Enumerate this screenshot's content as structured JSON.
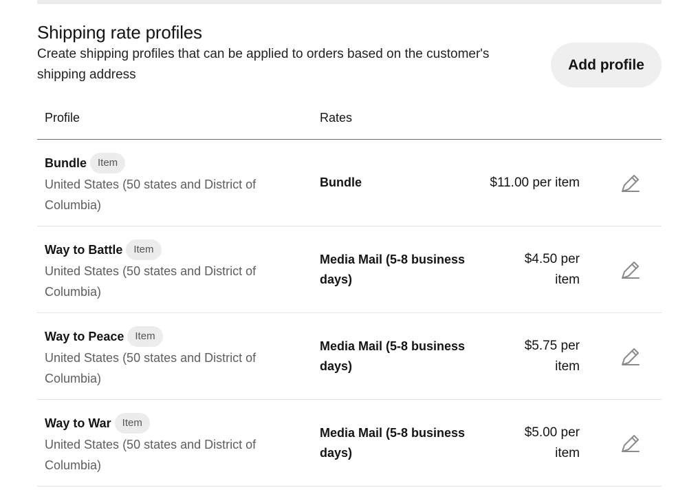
{
  "section": {
    "title": "Shipping rate profiles",
    "description": "Create shipping profiles that can be applied to orders based on the customer's shipping address",
    "add_button_label": "Add profile"
  },
  "table": {
    "columns": [
      "Profile",
      "Rates"
    ],
    "rows": [
      {
        "name": "Bundle",
        "badge": "Item",
        "region": "United States (50 states and District of Columbia)",
        "rate_name": "Bundle",
        "rate_price": "$11.00 per item",
        "edit_icon": "pencil-icon"
      },
      {
        "name": "Way to Battle",
        "badge": "Item",
        "region": "United States (50 states and District of Columbia)",
        "rate_name": "Media Mail (5-8 business days)",
        "rate_price": "$4.50 per item",
        "edit_icon": "pencil-icon"
      },
      {
        "name": "Way to Peace",
        "badge": "Item",
        "region": "United States (50 states and District of Columbia)",
        "rate_name": "Media Mail (5-8 business days)",
        "rate_price": "$5.75 per item",
        "edit_icon": "pencil-icon"
      },
      {
        "name": "Way to War",
        "badge": "Item",
        "region": "United States (50 states and District of Columbia)",
        "rate_name": "Media Mail (5-8 business days)",
        "rate_price": "$5.00 per item",
        "edit_icon": "pencil-icon"
      }
    ]
  },
  "colors": {
    "text": "#141414",
    "muted_text": "#5e5e5e",
    "button_bg": "#efefef",
    "badge_bg": "#ececec",
    "divider": "#e3e3e3",
    "icon": "#8a8a8a"
  }
}
